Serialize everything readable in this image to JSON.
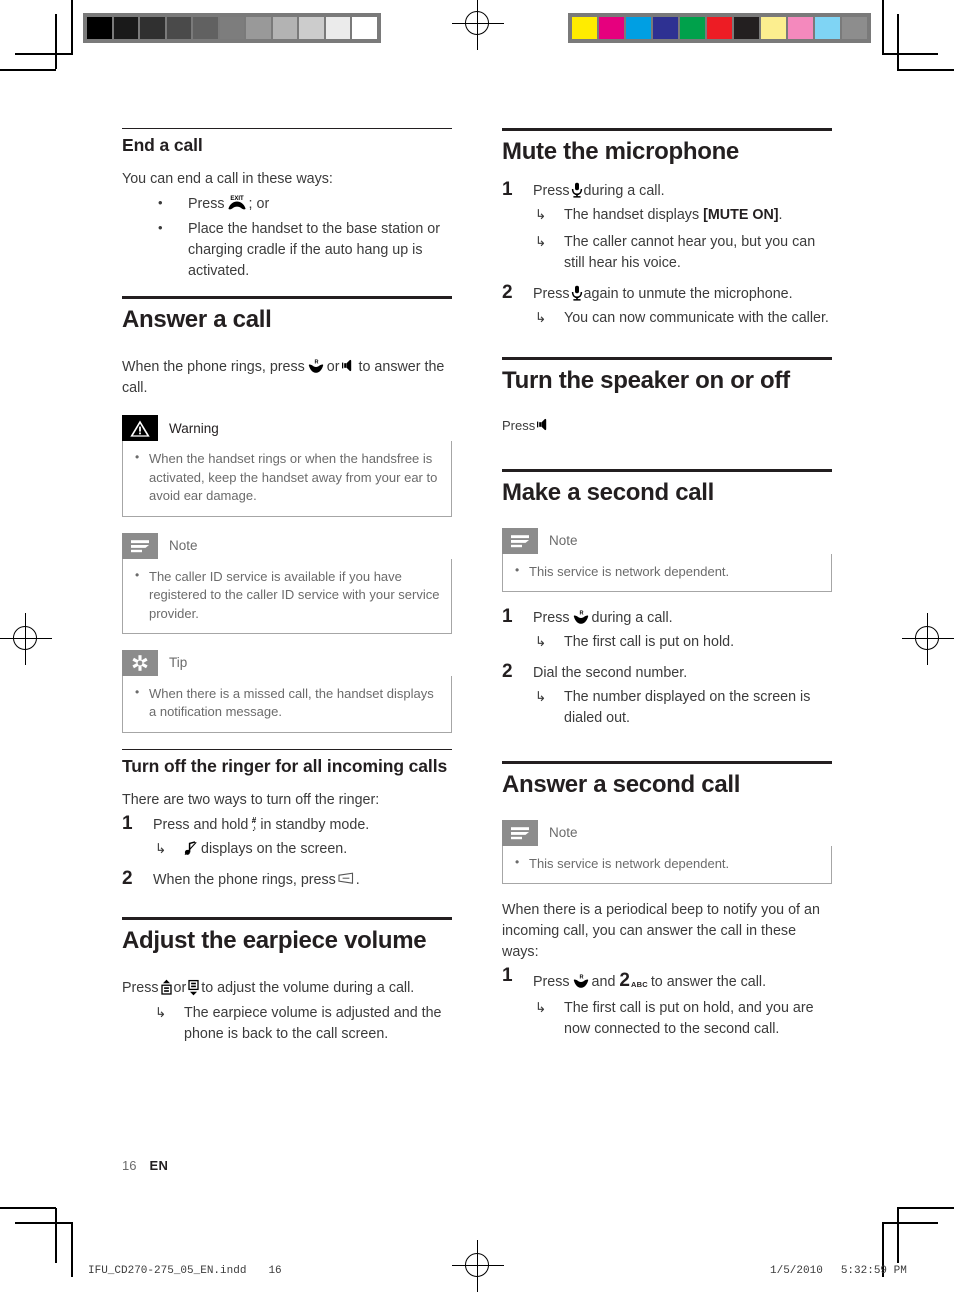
{
  "print_marks": {
    "gray_wedge": [
      "#000000",
      "#1a1a1a",
      "#303030",
      "#4a4a4a",
      "#616161",
      "#7d7d7d",
      "#999999",
      "#b3b3b3",
      "#cccccc",
      "#ebebeb",
      "#ffffff"
    ],
    "color_bar": [
      "#ffec00",
      "#e6007e",
      "#009fe3",
      "#2e3192",
      "#00a14b",
      "#ed1c24",
      "#231f20",
      "#fcee8f",
      "#f489bd",
      "#7fd4f4",
      "#8d8d8d"
    ]
  },
  "left_column": {
    "section_end_call": {
      "title": "End a call",
      "intro": "You can end a call in these ways:",
      "bullets": [
        {
          "pre": "Press",
          "icon": "exit-key-icon",
          "post": "; or"
        },
        {
          "pre": "Place the handset to the base station or charging cradle if the auto hang up is activated.",
          "icon": null,
          "post": ""
        }
      ]
    },
    "section_answer_call": {
      "title": "Answer a call",
      "intro_pre": "When the phone rings, press",
      "intro_mid": "or",
      "intro_post": "to answer the call.",
      "warning": {
        "label": "Warning",
        "items": [
          "When the handset rings or when the handsfree is activated, keep the handset away from your ear to avoid ear damage."
        ]
      },
      "note": {
        "label": "Note",
        "items": [
          "The caller ID service is available if you have registered to the caller ID service with your service provider."
        ]
      },
      "tip": {
        "label": "Tip",
        "items": [
          "When there is a missed call, the handset displays a notification message."
        ]
      }
    },
    "section_turn_off_ringer": {
      "title": "Turn off the ringer for all incoming calls",
      "intro": "There are two ways to turn off the ringer:",
      "steps": [
        {
          "num": "1",
          "pre": "Press and hold",
          "icon": "hash-key-icon",
          "post": "in standby mode.",
          "results": [
            {
              "pre": "",
              "icon": "ringer-off-icon",
              "post": "displays on the screen."
            }
          ]
        },
        {
          "num": "2",
          "pre": "When the phone rings, press",
          "icon": "softkey-icon",
          "post": ".",
          "results": []
        }
      ]
    },
    "section_earpiece_volume": {
      "title": "Adjust the earpiece volume",
      "intro_pre": "Press",
      "intro_mid": "or",
      "intro_post": "to adjust the volume during a call.",
      "results": [
        "The earpiece volume is adjusted and the phone is back to the call screen."
      ]
    }
  },
  "right_column": {
    "section_mute": {
      "title": "Mute the microphone",
      "steps": [
        {
          "num": "1",
          "pre": "Press",
          "icon": "mute-mic-icon",
          "post": "during a call.",
          "results": [
            {
              "pre": "The handset displays ",
              "bold": "[MUTE ON]",
              "post": "."
            },
            {
              "pre": "The caller cannot hear you, but you can still hear his voice.",
              "bold": "",
              "post": ""
            }
          ]
        },
        {
          "num": "2",
          "pre": "Press",
          "icon": "mute-mic-icon",
          "post": "again to unmute the microphone.",
          "results": [
            {
              "pre": "You can now communicate with the caller.",
              "bold": "",
              "post": ""
            }
          ]
        }
      ]
    },
    "section_speaker": {
      "title": "Turn the speaker on or off",
      "intro_pre": "Press",
      "icon": "speaker-icon"
    },
    "section_make_second_call": {
      "title": "Make a second call",
      "note": {
        "label": "Note",
        "items": [
          "This service is network dependent."
        ]
      },
      "steps": [
        {
          "num": "1",
          "pre": "Press",
          "icon": "talk-r-key-icon",
          "post": "during a call.",
          "results": [
            "The first call is put on hold."
          ]
        },
        {
          "num": "2",
          "pre": "Dial the second number.",
          "icon": null,
          "post": "",
          "results": [
            "The number displayed on the screen is dialed out."
          ]
        }
      ]
    },
    "section_answer_second_call": {
      "title": "Answer a second call",
      "note": {
        "label": "Note",
        "items": [
          "This service is network dependent."
        ]
      },
      "intro": "When there is a periodical beep to notify you of an incoming call, you can answer the call in these ways:",
      "steps": [
        {
          "num": "1",
          "pre": "Press",
          "icon": "talk-r-key-icon",
          "mid": "and",
          "key_label": "2",
          "key_sub": "ABC",
          "post": "to answer the call.",
          "results": [
            "The first call is put on hold, and you are now connected to the second call."
          ]
        }
      ]
    }
  },
  "footer": {
    "page_number": "16",
    "language": "EN"
  },
  "slug": {
    "filename": "IFU_CD270-275_05_EN.indd",
    "page": "16",
    "date": "1/5/2010",
    "time": "5:32:59 PM"
  }
}
